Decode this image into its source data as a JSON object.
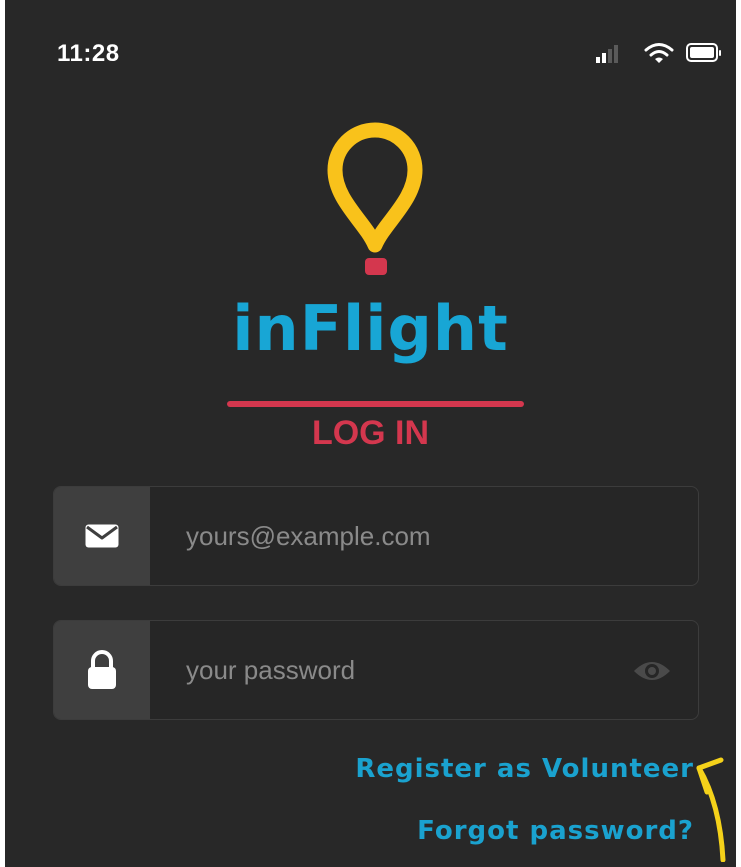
{
  "status_bar": {
    "time": "11:28",
    "icons": [
      "signal-icon",
      "wifi-icon",
      "battery-icon"
    ]
  },
  "logo": {
    "wordmark": "inFlight",
    "subtitle": "LOG IN"
  },
  "login_form": {
    "email": {
      "placeholder": "yours@example.com",
      "value": "",
      "icon": "envelope-icon"
    },
    "password": {
      "placeholder": "your password",
      "value": "",
      "icon": "lock-icon",
      "toggle_icon": "eye-icon"
    }
  },
  "links": {
    "register": "Register as Volunteer",
    "forgot": "Forgot password?"
  },
  "colors": {
    "background": "#282828",
    "accent_blue": "#18a6d5",
    "accent_red": "#d4374e",
    "pin_yellow": "#f9c21b"
  }
}
